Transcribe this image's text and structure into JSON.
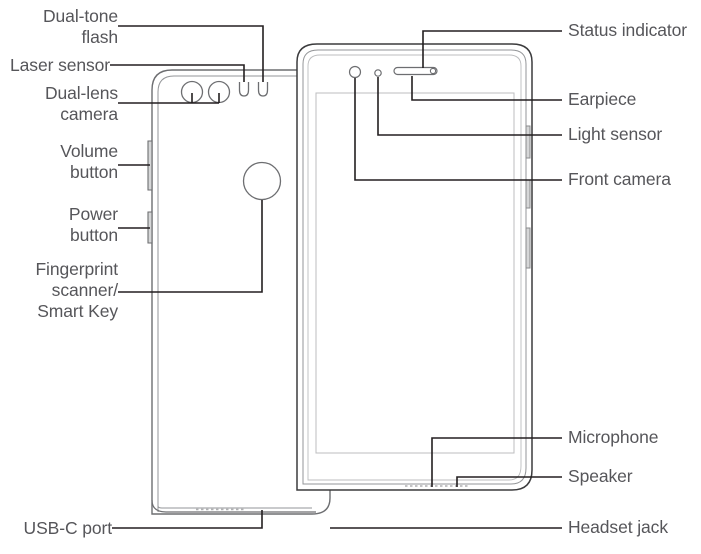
{
  "figure": {
    "type": "smartphone-hardware-callout-diagram",
    "views": [
      {
        "name": "rear-view",
        "description": "Back of phone"
      },
      {
        "name": "front-view",
        "description": "Front of phone"
      }
    ],
    "line_color": "#231f20",
    "outline_color": "#6d6e71",
    "text_color": "#56565a",
    "background": "#ffffff"
  },
  "labels": {
    "left": [
      {
        "id": "dual-tone-flash",
        "text": "Dual-tone\nflash"
      },
      {
        "id": "laser-sensor",
        "text": "Laser sensor"
      },
      {
        "id": "dual-lens-camera",
        "text": "Dual-lens\ncamera"
      },
      {
        "id": "volume-button",
        "text": "Volume\nbutton"
      },
      {
        "id": "power-button",
        "text": "Power\nbutton"
      },
      {
        "id": "fingerprint-scanner",
        "text": "Fingerprint\nscanner/\nSmart Key"
      },
      {
        "id": "usb-c-port",
        "text": "USB-C port"
      }
    ],
    "right": [
      {
        "id": "status-indicator",
        "text": "Status indicator"
      },
      {
        "id": "earpiece",
        "text": "Earpiece"
      },
      {
        "id": "light-sensor",
        "text": "Light sensor"
      },
      {
        "id": "front-camera",
        "text": "Front camera"
      },
      {
        "id": "microphone",
        "text": "Microphone"
      },
      {
        "id": "speaker",
        "text": "Speaker"
      },
      {
        "id": "headset-jack",
        "text": "Headset jack"
      }
    ]
  }
}
